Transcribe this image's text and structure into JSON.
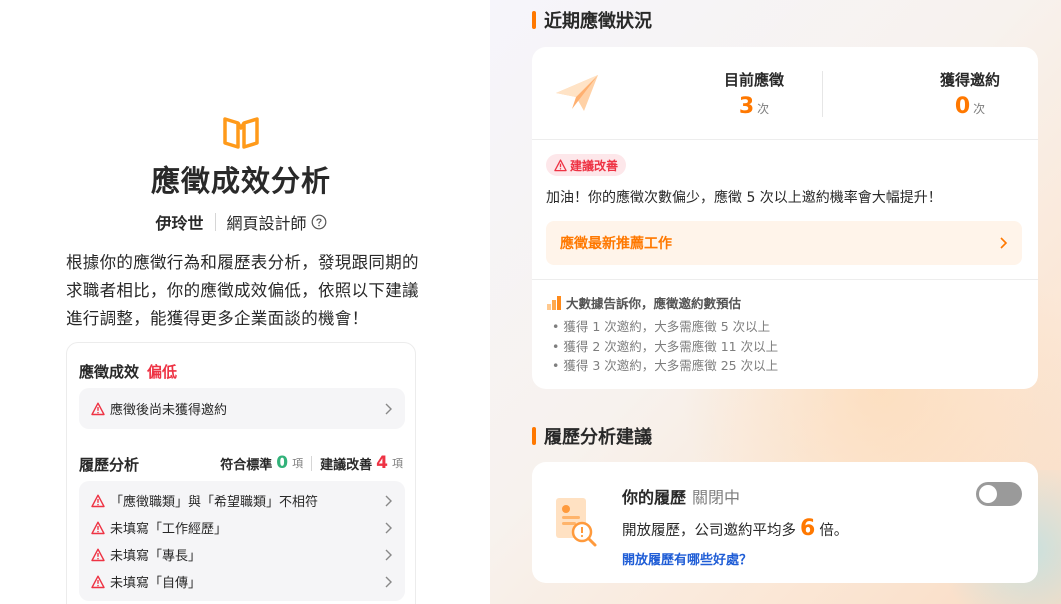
{
  "left": {
    "title": "應徵成效分析",
    "user": {
      "name": "伊玲世",
      "job": "網頁設計師"
    },
    "description": "根據你的應徵行為和履歷表分析，發現跟同期的求職者相比，你的應徵成效偏低，依照以下建議進行調整，能獲得更多企業面談的機會！",
    "application_result": {
      "label": "應徵成效",
      "status": "偏低",
      "issues": [
        {
          "text": "應徵後尚未獲得邀約"
        }
      ]
    },
    "resume_analysis": {
      "label": "履歷分析",
      "meets_label": "符合標準",
      "meets_count": "0",
      "improve_label": "建議改善",
      "improve_count": "4",
      "unit": "項",
      "issues": [
        {
          "text": "「應徵職類」與「希望職類」不相符"
        },
        {
          "text": "未填寫「工作經歷」"
        },
        {
          "text": "未填寫「專長」"
        },
        {
          "text": "未填寫「自傳」"
        }
      ]
    }
  },
  "right": {
    "recent": {
      "heading": "近期應徵狀況",
      "applied_label": "目前應徵",
      "applied_value": "3",
      "invited_label": "獲得邀約",
      "invited_value": "0",
      "unit": "次",
      "badge": "建議改善",
      "advice": "加油！你的應徵次數偏少，應徵 5 次以上邀約機率會大幅提升！",
      "job_link": "應徵最新推薦工作",
      "data_title": "大數據告訴你，應徵邀約數預估",
      "data_points": [
        "獲得 1 次邀約，大多需應徵 5 次以上",
        "獲得 2 次邀約，大多需應徵 11 次以上",
        "獲得 3 次邀約，大多需應徵 25 次以上"
      ]
    },
    "resume": {
      "heading": "履歷分析建議",
      "title": "你的履歷",
      "state": "關閉中",
      "text_before": "開放履歷，公司邀約平均多",
      "multiplier": "6",
      "text_after": "倍。",
      "link": "開放履歷有哪些好處？",
      "toggle_on": false
    }
  },
  "colors": {
    "accent_orange": "#ff7800",
    "warning_red": "#ee3344",
    "success_green": "#33b27a",
    "link_blue": "#1f5dd6"
  },
  "icons": [
    "book-logo-icon",
    "help-circle-icon",
    "warning-icon",
    "chevron-right-icon",
    "paper-plane-icon",
    "bar-chart-icon",
    "resume-search-icon"
  ]
}
